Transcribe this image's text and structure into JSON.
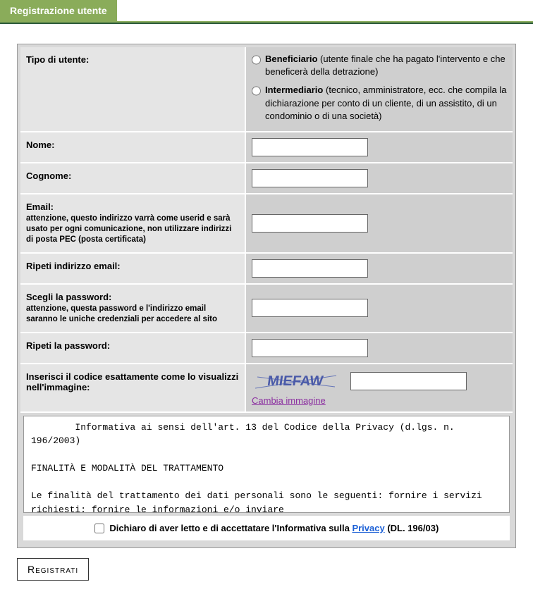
{
  "header": {
    "title": "Registrazione utente"
  },
  "fields": {
    "tipo_utente": {
      "label": "Tipo di utente:",
      "options": [
        {
          "name": "Beneficiario",
          "desc": "(utente finale che ha pagato l'intervento e che beneficerà della detrazione)"
        },
        {
          "name": "Intermediario",
          "desc": "(tecnico, amministratore, ecc. che compila la dichiarazione per conto di un cliente, di un assistito, di un condominio o di una società)"
        }
      ]
    },
    "nome": {
      "label": "Nome:"
    },
    "cognome": {
      "label": "Cognome:"
    },
    "email": {
      "label": "Email:",
      "hint": "attenzione, questo indirizzo varrà come userid e sarà usato per ogni comunicazione, non utilizzare indirizzi di posta PEC (posta certificata)"
    },
    "repeat_email": {
      "label": "Ripeti indirizzo email:"
    },
    "password": {
      "label": "Scegli la password:",
      "hint": "attenzione, questa password e l'indirizzo email saranno le uniche credenziali per accedere al sito"
    },
    "repeat_password": {
      "label": "Ripeti la password:"
    },
    "captcha": {
      "label": "Inserisci il codice esattamente come lo visualizzi nell'immagine:",
      "code": "MIEFAW",
      "change_link": "Cambia immagine"
    }
  },
  "terms": {
    "text": "        Informativa ai sensi dell'art. 13 del Codice della Privacy (d.lgs. n. 196/2003)\n\nFINALITÀ E MODALITÀ DEL TRATTAMENTO\n\nLe finalità del trattamento dei dati personali sono le seguenti: fornire i servizi richiesti; fornire le informazioni e/o inviare"
  },
  "accept": {
    "prefix": "Dichiaro di aver letto e di accettatare l'Informativa sulla ",
    "privacy": "Privacy",
    "suffix": " (DL. 196/03)"
  },
  "submit": {
    "label": "Registrati"
  }
}
